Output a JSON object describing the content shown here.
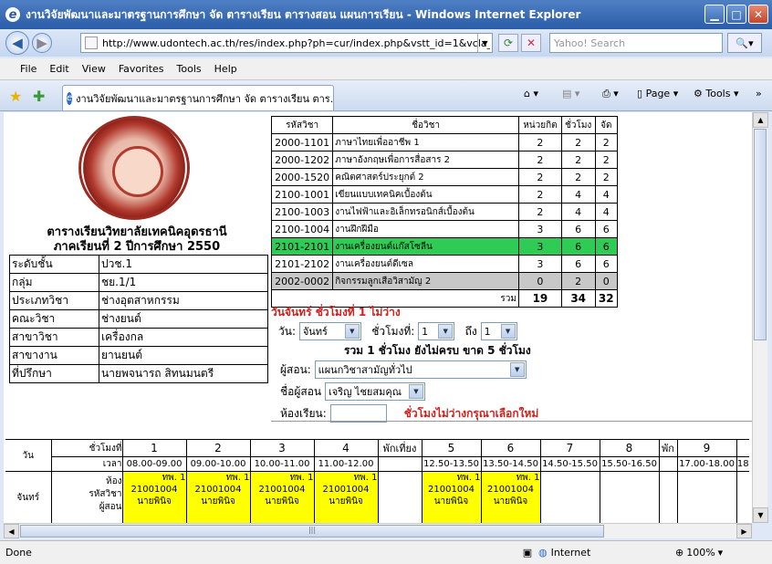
{
  "window": {
    "title": "งานวิจัยพัฒนาและมาตรฐานการศึกษา จัด ตารางเรียน ตารางสอน แผนการเรียน - Windows Internet Explorer"
  },
  "address": {
    "url": "http://www.udontech.ac.th/res/index.php?ph=cur/index.php&vstt_id=1&vcla_id=01"
  },
  "search": {
    "placeholder": "Yahoo! Search"
  },
  "menu": [
    "File",
    "Edit",
    "View",
    "Favorites",
    "Tools",
    "Help"
  ],
  "tab": {
    "label": "งานวิจัยพัฒนาและมาตรฐานการศึกษา จัด ตารางเรียน ตาร..."
  },
  "toolbar": {
    "page": "Page",
    "tools": "Tools"
  },
  "left": {
    "title1": "ตารางเรียนวิทยาลัยเทคนิคอุดรธานี",
    "title2": "ภาคเรียนที่  2   ปีการศึกษา  2550",
    "rows": [
      {
        "k": "ระดับชั้น",
        "v": "ปวช.1"
      },
      {
        "k": "กลุ่ม",
        "v": "ชย.1/1"
      },
      {
        "k": "ประเภทวิชา",
        "v": "ช่างอุตสาหกรรม"
      },
      {
        "k": "คณะวิชา",
        "v": "ช่างยนต์"
      },
      {
        "k": "สาขาวิชา",
        "v": "เครื่องกล"
      },
      {
        "k": "สาขางาน",
        "v": "ยานยนต์"
      },
      {
        "k": "ที่ปรึกษา",
        "v": "นายพจนารถ สิทนมนตรี"
      }
    ]
  },
  "subjects": {
    "headers": [
      "รหัสวิชา",
      "ชื่อวิชา",
      "หน่วยกิต",
      "ชั่วโมง",
      "จัด"
    ],
    "rows": [
      {
        "code": "2000-1101",
        "name": "ภาษาไทยเพื่ออาชีพ 1",
        "credit": "2",
        "hours": "2",
        "assigned": "2",
        "hl": ""
      },
      {
        "code": "2000-1202",
        "name": "ภาษาอังกฤษเพื่อการสื่อสาร 2",
        "credit": "2",
        "hours": "2",
        "assigned": "2",
        "hl": ""
      },
      {
        "code": "2000-1520",
        "name": "คณิตศาสตร์ประยุกต์ 2",
        "credit": "2",
        "hours": "2",
        "assigned": "2",
        "hl": ""
      },
      {
        "code": "2100-1001",
        "name": "เขียนแบบเทคนิคเบื้องต้น",
        "credit": "2",
        "hours": "4",
        "assigned": "4",
        "hl": ""
      },
      {
        "code": "2100-1003",
        "name": "งานไฟฟ้าและอิเล็กทรอนิกส์เบื้องต้น",
        "credit": "2",
        "hours": "4",
        "assigned": "4",
        "hl": ""
      },
      {
        "code": "2100-1004",
        "name": "งานฝึกฝีมือ",
        "credit": "3",
        "hours": "6",
        "assigned": "6",
        "hl": ""
      },
      {
        "code": "2101-2101",
        "name": "งานเครื่องยนต์แก๊สโซลีน",
        "credit": "3",
        "hours": "6",
        "assigned": "6",
        "hl": "green"
      },
      {
        "code": "2101-2102",
        "name": "งานเครื่องยนต์ดีเซล",
        "credit": "3",
        "hours": "6",
        "assigned": "6",
        "hl": ""
      },
      {
        "code": "2002-0002",
        "name": "กิจกรรมลูกเสือวิสามัญ 2",
        "credit": "0",
        "hours": "2",
        "assigned": "0",
        "hl": "gray"
      }
    ],
    "total_label": "รวม",
    "total_credit": "19",
    "total_hours": "34",
    "total_assigned": "32"
  },
  "form": {
    "status": "วันจันทร์  ชั่วโมงที่   1   ไม่ว่าง",
    "day_label": "วัน:",
    "day_value": "จันทร์",
    "period_label": "ชั่วโมงที่:",
    "period_value": "1",
    "to_label": "ถึง",
    "to_value": "1",
    "summary": "รวม 1 ชั่วโมง ยังไม่ครบ ขาด  5 ชั่วโมง",
    "teacher_label": "ผู้สอน:",
    "teacher_value": "แผนกวิชาสามัญทั่วไป",
    "teacher_name_label": "ชื่อผู้สอน",
    "teacher_name_value": "เจริญ  ไชยสมคุณ",
    "room_label": "ห้องเรียน:",
    "warning": "ชั่วโมงไม่ว่างกรุณาเลือกใหม่"
  },
  "schedule": {
    "day_col": "วัน",
    "period_label": "ชั่วโมงที่",
    "time_label": "เวลา",
    "periods": [
      "1",
      "2",
      "3",
      "4",
      "พักเที่ยง",
      "5",
      "6",
      "7",
      "8",
      "พัก",
      "9"
    ],
    "times": [
      "08.00-09.00",
      "09.00-10.00",
      "10.00-11.00",
      "11.00-12.00",
      "",
      "12.50-13.50",
      "13.50-14.50",
      "14.50-15.50",
      "15.50-16.50",
      "",
      "17.00-18.00",
      "18"
    ],
    "row_day": "จันทร์",
    "row_labels": [
      "ห้อง",
      "รหัสวิชา",
      "ผู้สอน"
    ],
    "cells": [
      {
        "room": "ทพ. 1",
        "code": "21001004",
        "teacher": "นายพินิจ"
      },
      {
        "room": "ทพ. 1",
        "code": "21001004",
        "teacher": "นายพินิจ"
      },
      {
        "room": "ทพ. 1",
        "code": "21001004",
        "teacher": "นายพินิจ"
      },
      {
        "room": "ทพ. 1",
        "code": "21001004",
        "teacher": "นายพินิจ"
      },
      {
        "room": "ทพ. 1",
        "code": "21001004",
        "teacher": "นายพินิจ"
      },
      {
        "room": "ทพ. 1",
        "code": "21001004",
        "teacher": "นายพินิจ"
      }
    ]
  },
  "status": {
    "left": "Done",
    "zone": "Internet",
    "zoom": "100%"
  }
}
